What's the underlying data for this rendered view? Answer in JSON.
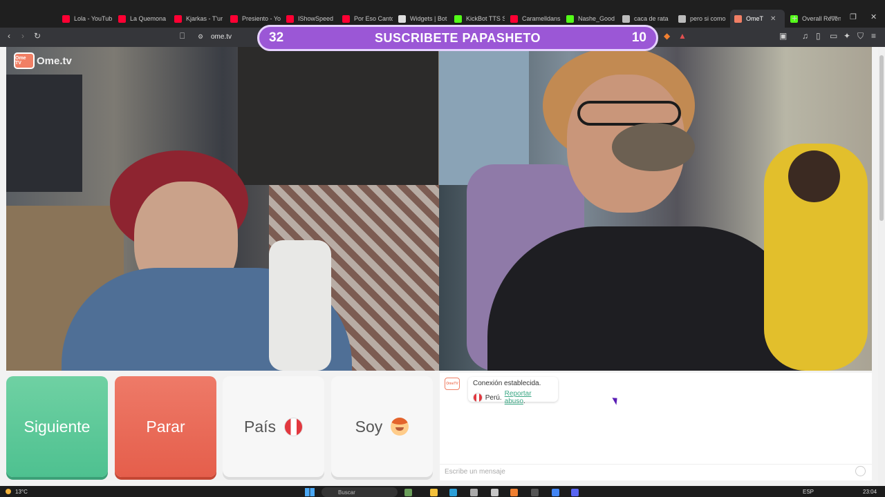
{
  "browser": {
    "tabs": [
      {
        "title": "Lola - YouTub",
        "color": "#ff0033"
      },
      {
        "title": "La Quemona",
        "color": "#ff0033"
      },
      {
        "title": "Kjarkas - T'ur",
        "color": "#ff0033"
      },
      {
        "title": "Presiento - Yo",
        "color": "#ff0033"
      },
      {
        "title": "IShowSpeed",
        "color": "#ff0033"
      },
      {
        "title": "Por Eso Canto",
        "color": "#ff0033"
      },
      {
        "title": "Widgets | Bot",
        "color": "#dddddd"
      },
      {
        "title": "KickBot TTS S",
        "color": "#53fc18"
      },
      {
        "title": "Caramelldans",
        "color": "#ff0033"
      },
      {
        "title": "Nashe_Good",
        "color": "#53fc18"
      },
      {
        "title": "caca de rata",
        "color": "#bbbbbb"
      },
      {
        "title": "pero si como",
        "color": "#bbbbbb"
      },
      {
        "title": "OmeT",
        "color": "#f07f65"
      },
      {
        "title": "Overall Reven",
        "color": "#53fc18"
      }
    ],
    "active_tab_index": 12,
    "url": "ome.tv"
  },
  "overlay": {
    "left_count": "32",
    "title": "SUSCRIBETE PAPASHETO",
    "right_count": "10",
    "color": "#9b57d6"
  },
  "site": {
    "logo_badge": "Ome TV",
    "logo_text": "Ome.tv"
  },
  "controls": {
    "next_label": "Siguiente",
    "stop_label": "Parar",
    "country_label": "País",
    "gender_label": "Soy",
    "next_color": "#5cc99a",
    "stop_color": "#ea6b58"
  },
  "chat": {
    "connected_text": "Conexión establecida.",
    "country": "Perú.",
    "report_link": "Reportar abuso",
    "report_suffix": ".",
    "input_placeholder": "Escribe un mensaje"
  },
  "taskbar": {
    "temperature": "13°C",
    "search_label": "Buscar",
    "language": "ESP",
    "time": "23:04"
  }
}
